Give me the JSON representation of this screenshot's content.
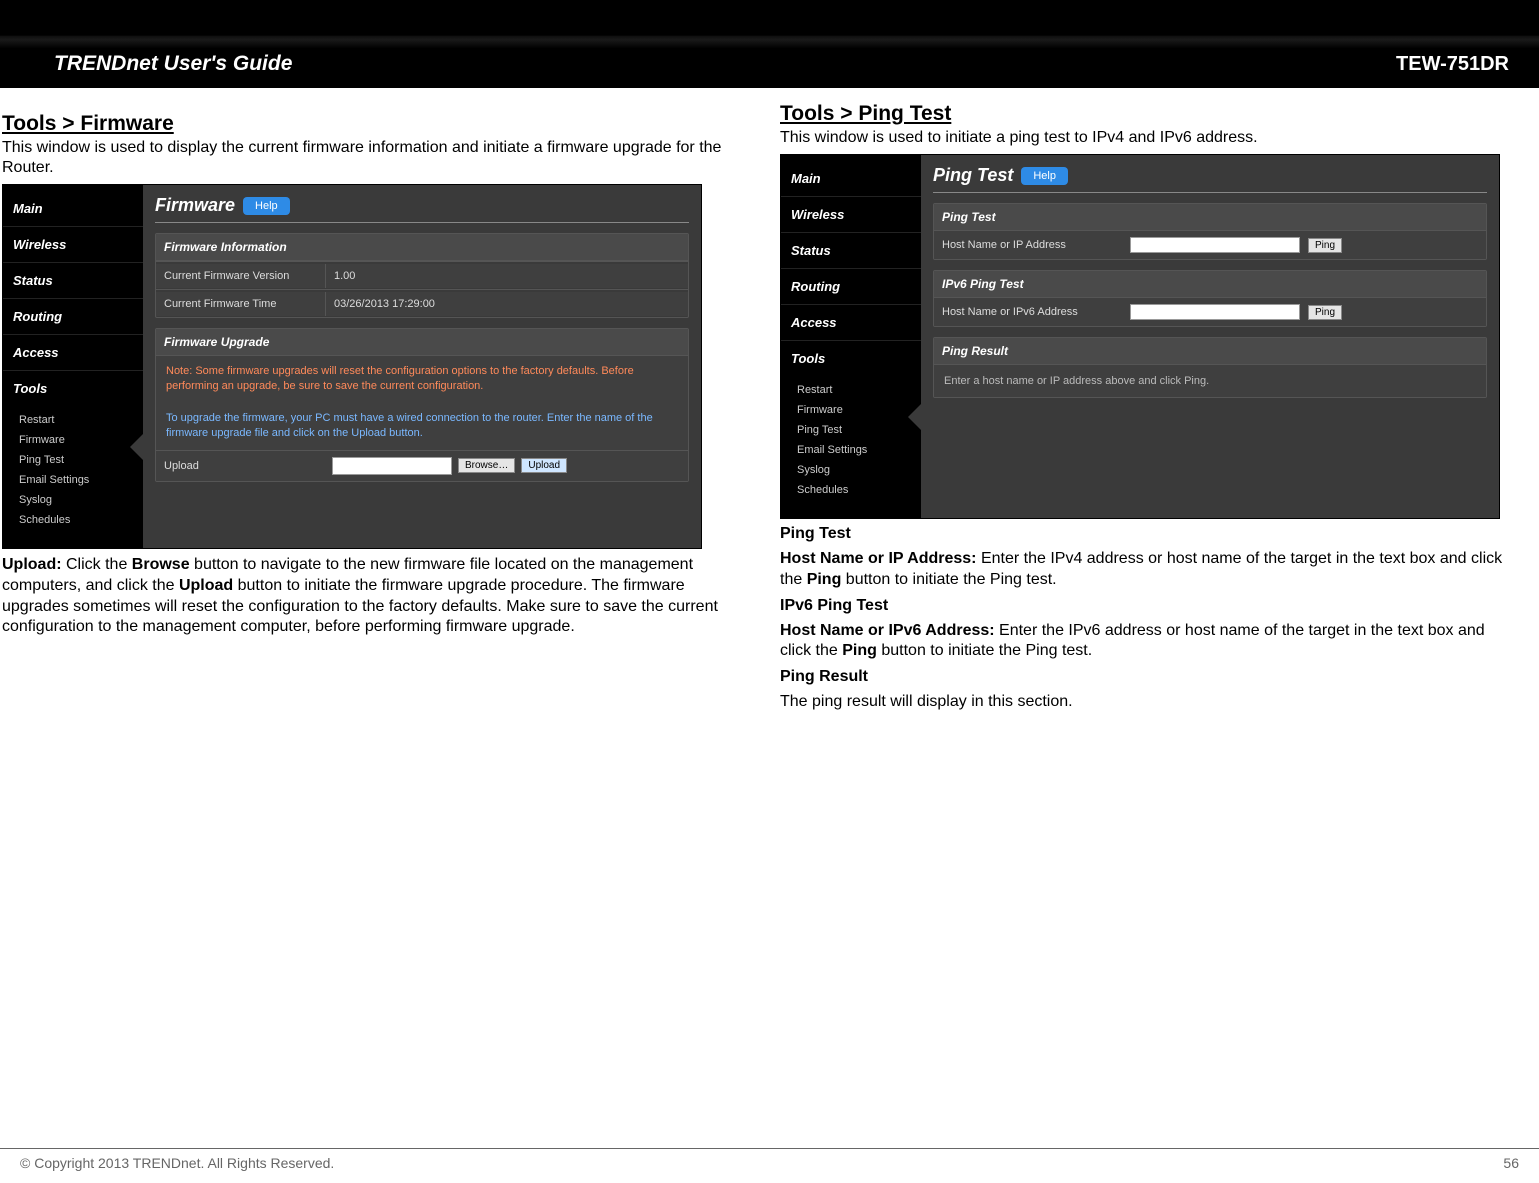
{
  "header": {
    "title_left": "TRENDnet User's Guide",
    "title_right": "TEW-751DR"
  },
  "footer": {
    "copyright": "© Copyright 2013 TRENDnet. All Rights Reserved.",
    "page_number": "56"
  },
  "shared_ui": {
    "help_label": "Help",
    "nav": {
      "main": "Main",
      "wireless": "Wireless",
      "status": "Status",
      "routing": "Routing",
      "access": "Access",
      "tools": "Tools"
    },
    "tools_sub": [
      "Restart",
      "Firmware",
      "Ping Test",
      "Email Settings",
      "Syslog",
      "Schedules"
    ]
  },
  "firmware": {
    "heading": "Tools > Firmware",
    "description": "This window is used to display the current firmware information and initiate a firmware upgrade for the Router.",
    "page_title": "Firmware",
    "panel_info": "Firmware Information",
    "row_version_label": "Current Firmware Version",
    "row_version_value": "1.00",
    "row_time_label": "Current Firmware Time",
    "row_time_value": "03/26/2013 17:29:00",
    "panel_upgrade": "Firmware Upgrade",
    "note_red": "Note: Some firmware upgrades will reset the configuration options to the factory defaults. Before performing an upgrade, be sure to save the current configuration.",
    "note_blue": "To upgrade the firmware, your PC must have a wired connection to the router. Enter the name of the firmware upgrade file and click on the Upload button.",
    "upload_label": "Upload",
    "browse_btn": "Browse…",
    "upload_btn": "Upload",
    "caption_upload_bold": "Upload:",
    "caption_text_a": " Click the ",
    "caption_browse_bold": "Browse",
    "caption_text_b": " button to navigate to the new firmware file located on the management computers, and click the ",
    "caption_upload2_bold": "Upload",
    "caption_text_c": " button to initiate the firmware upgrade procedure. The firmware upgrades sometimes will reset the configuration to the factory defaults. Make sure to save the current configuration to the management computer, before performing firmware upgrade."
  },
  "ping": {
    "heading": "Tools > Ping Test",
    "description": "This window is used to initiate a ping test to IPv4 and IPv6 address.",
    "page_title": "Ping Test",
    "panel_ipv4": "Ping Test",
    "row_ipv4_label": "Host Name or IP Address",
    "panel_ipv6": "IPv6 Ping Test",
    "row_ipv6_label": "Host Name or IPv6 Address",
    "ping_btn": "Ping",
    "panel_result": "Ping Result",
    "result_text": "Enter a host name or IP address above and click Ping.",
    "sub_ping_test": "Ping Test",
    "cap_ipv4_bold": "Host Name or IP Address:",
    "cap_ipv4_a": " Enter the IPv4 address or host name of the target in the text box and click the ",
    "cap_ping_bold": "Ping",
    "cap_ipv4_b": " button to initiate the Ping test.",
    "sub_ipv6_test": "IPv6 Ping Test",
    "cap_ipv6_bold": "Host Name or IPv6 Address:",
    "cap_ipv6_a": " Enter the IPv6 address or host name of the target in the text box and click the ",
    "cap_ipv6_b": " button to initiate the Ping test.",
    "sub_result": "Ping Result",
    "cap_result": "The ping result will display in this section."
  }
}
